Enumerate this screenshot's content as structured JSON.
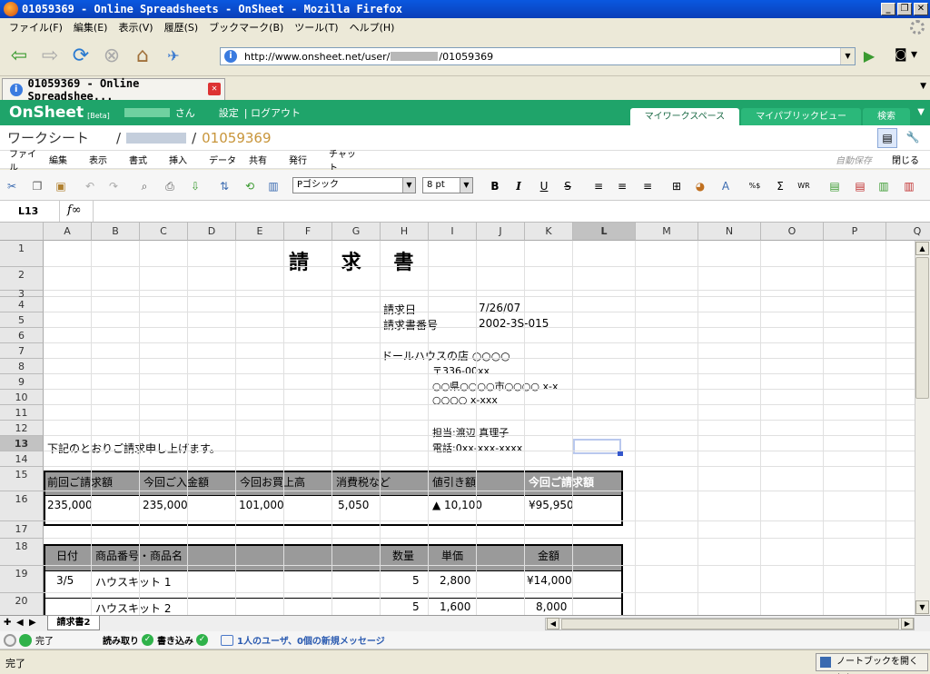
{
  "browser": {
    "window_title": "01059369 - Online Spreadsheets - OnSheet - Mozilla Firefox",
    "menu": [
      "ファイル(F)",
      "編集(E)",
      "表示(V)",
      "履歴(S)",
      "ブックマーク(B)",
      "ツール(T)",
      "ヘルプ(H)"
    ],
    "url_prefix": "http://www.onsheet.net/user/",
    "url_suffix": "/01059369",
    "tab_title": "01059369 - Online Spreadshee...",
    "status": "完了",
    "notebook_button": "ノートブックを開く(N)"
  },
  "onsheet": {
    "logo": "OnSheet",
    "beta": "[Beta]",
    "san": "さん",
    "settings": "設定",
    "logout": "| ログアウト",
    "tabs": [
      "マイワークスペース",
      "マイパブリックビュー",
      "検索"
    ],
    "breadcrumb_root": "ワークシート",
    "doc_id": "01059369",
    "menu": [
      "ファイル",
      "編集",
      "表示",
      "書式",
      "挿入",
      "データ",
      "共有",
      "発行",
      "チャット"
    ],
    "autosave": "自動保存",
    "close": "閉じる",
    "font": "Pゴシック",
    "font_size": "8 pt",
    "cell_ref": "L13",
    "fx": "f∞"
  },
  "grid": {
    "columns": [
      "A",
      "B",
      "C",
      "D",
      "E",
      "F",
      "G",
      "H",
      "I",
      "J",
      "K",
      "L",
      "M",
      "N",
      "O",
      "P",
      "Q"
    ],
    "rows": [
      "1",
      "2",
      "3",
      "4",
      "5",
      "6",
      "7",
      "8",
      "9",
      "10",
      "11",
      "12",
      "13",
      "14",
      "15",
      "16",
      "17",
      "18",
      "19",
      "20"
    ],
    "selected_column": "L",
    "selected_row": "13"
  },
  "invoice": {
    "title": "請 求 書",
    "date_label": "請求日",
    "date_value": "7/26/07",
    "number_label": "請求書番号",
    "number_value": "2002-3S-015",
    "customer": "ドールハウスの店 ○○○○",
    "postal": "〒336-00xx",
    "address1": "○○県○○○○市○○○○ x-x",
    "address2": "○○○○ x-xxx",
    "contact": "担当:渡辺 真理子",
    "phone": "電話:0xx-xxx-xxxx",
    "intro": "下記のとおりご請求申し上げます。",
    "summary_headers": [
      "前回ご請求額",
      "今回ご入金額",
      "今回お買上高",
      "消費税など",
      "値引き額",
      "今回ご請求額"
    ],
    "summary_values": [
      "235,000",
      "235,000",
      "101,000",
      "5,050",
      "▲ 10,100",
      "¥95,950"
    ],
    "detail_headers": [
      "日付",
      "商品番号・商品名",
      "数量",
      "単価",
      "金額"
    ],
    "detail_rows": [
      {
        "date": "3/5",
        "item": "ハウスキット 1",
        "qty": "5",
        "price": "2,800",
        "amount": "¥14,000"
      },
      {
        "date": "",
        "item": "ハウスキット 2",
        "qty": "5",
        "price": "1,600",
        "amount": "8,000"
      }
    ]
  },
  "sheet_tab": "請求書2",
  "app_status": {
    "state": "完了",
    "read": "読み取り",
    "write": "書き込み",
    "message": "1人のユーザ、0個の新規メッセージ"
  }
}
